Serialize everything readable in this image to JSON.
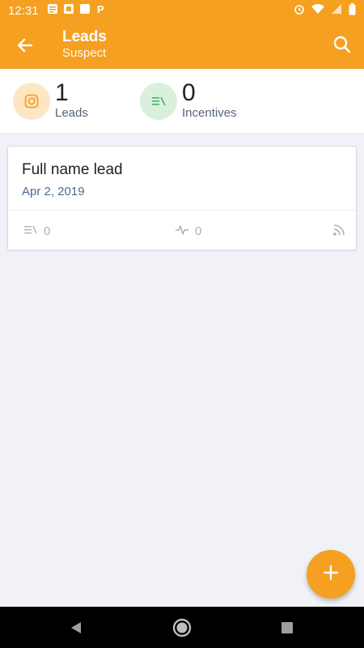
{
  "status_bar": {
    "time": "12:31",
    "left_icons": [
      "notes-icon",
      "screenshot-icon",
      "square-icon",
      "parking-icon"
    ],
    "right_icons": [
      "alarm-icon",
      "wifi-icon",
      "signal-icon",
      "battery-icon"
    ]
  },
  "app_bar": {
    "title": "Leads",
    "subtitle": "Suspect",
    "back_icon": "arrow-back-icon",
    "search_icon": "search-icon"
  },
  "summary": {
    "leads": {
      "count": "1",
      "label": "Leads",
      "icon": "instagram-icon"
    },
    "incentives": {
      "count": "0",
      "label": "Incentives",
      "icon": "list-icon"
    }
  },
  "lead_card": {
    "name": "Full name lead",
    "date": "Apr 2, 2019",
    "incentives_count": "0",
    "activity_count": "0",
    "feed_icon": "rss-icon"
  },
  "fab": {
    "icon": "plus-icon"
  },
  "nav_bar": {
    "icons": [
      "back-triangle-icon",
      "home-circle-icon",
      "recents-square-icon"
    ]
  },
  "colors": {
    "accent": "#f5a021",
    "background": "#f1f2f7",
    "leads_circle": "#fde7c3",
    "incentives_circle": "#d9f0dc"
  }
}
